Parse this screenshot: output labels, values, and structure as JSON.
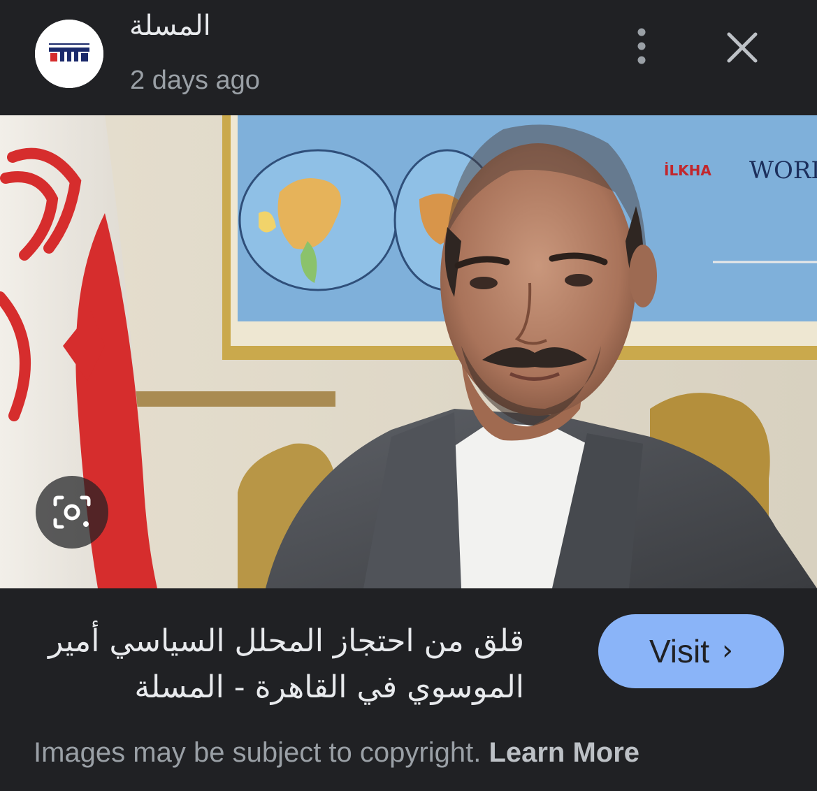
{
  "header": {
    "source_name": "المسلة",
    "timestamp": "2 days ago",
    "logo_text": "المسلة"
  },
  "image": {
    "map_text_1": "İLKHA",
    "map_text_2": "WORL"
  },
  "article": {
    "title": "قلق من احتجاز المحلل السياسي أمير الموسوي في القاهرة - المسلة"
  },
  "actions": {
    "visit_label": "Visit",
    "visit_chevron": "›"
  },
  "footer": {
    "copyright_text": "Images may be subject to copyright. ",
    "learn_more": "Learn More"
  },
  "colors": {
    "background": "#202124",
    "accent": "#8ab4f8",
    "text_primary": "#e8eaed",
    "text_secondary": "#9aa0a6",
    "flag_red": "#d62d2d"
  },
  "icons": {
    "more": "more-vert-icon",
    "close": "close-icon",
    "lens": "google-lens-icon"
  }
}
